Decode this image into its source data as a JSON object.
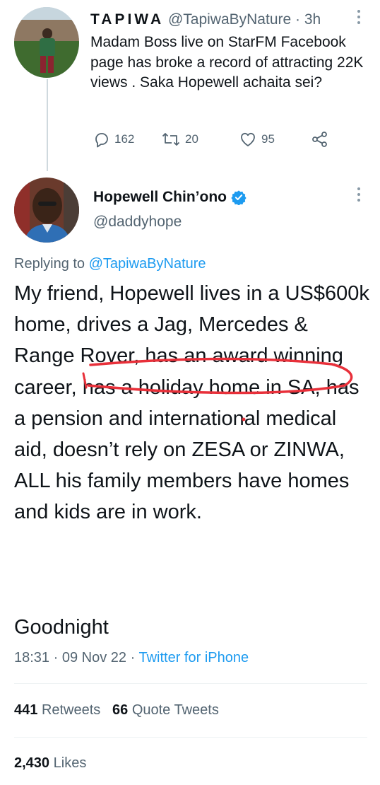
{
  "reply": {
    "name": "TAPIWA",
    "handle": "@TapiwaByNature",
    "separator": "·",
    "time": "3h",
    "text": "Madam Boss live on StarFM Facebook page has broke a record of attracting 22K views . Saka Hopewell achaita sei?",
    "actions": {
      "comments": "162",
      "retweets": "20",
      "likes": "95"
    }
  },
  "tweet": {
    "name": "Hopewell Chin’ono",
    "handle": "@daddyhope",
    "replying_label": "Replying to",
    "replying_handle": "@TapiwaByNature",
    "text": "My friend, Hopewell lives in a US$600k home, drives a Jag, Mercedes & Range Rover, has an award winning career, has a holiday home in SA, has a pension and international medical aid, doesn’t rely on ZESA or ZINWA, ALL his family members have homes and kids are in work.",
    "goodnight": "Goodnight",
    "time": "18:31",
    "date": "09 Nov 22",
    "separator": "·",
    "source": "Twitter for iPhone",
    "retweets_count": "441",
    "retweets_label": "Retweets",
    "quotes_count": "66",
    "quotes_label": "Quote Tweets",
    "likes_count": "2,430",
    "likes_label": "Likes"
  },
  "colors": {
    "accent": "#1d9bf0",
    "secondary_text": "#536471",
    "annotation": "#e8303a"
  },
  "icons": [
    "reply-icon",
    "retweet-icon",
    "like-icon",
    "share-icon",
    "verified-icon",
    "more-icon"
  ]
}
